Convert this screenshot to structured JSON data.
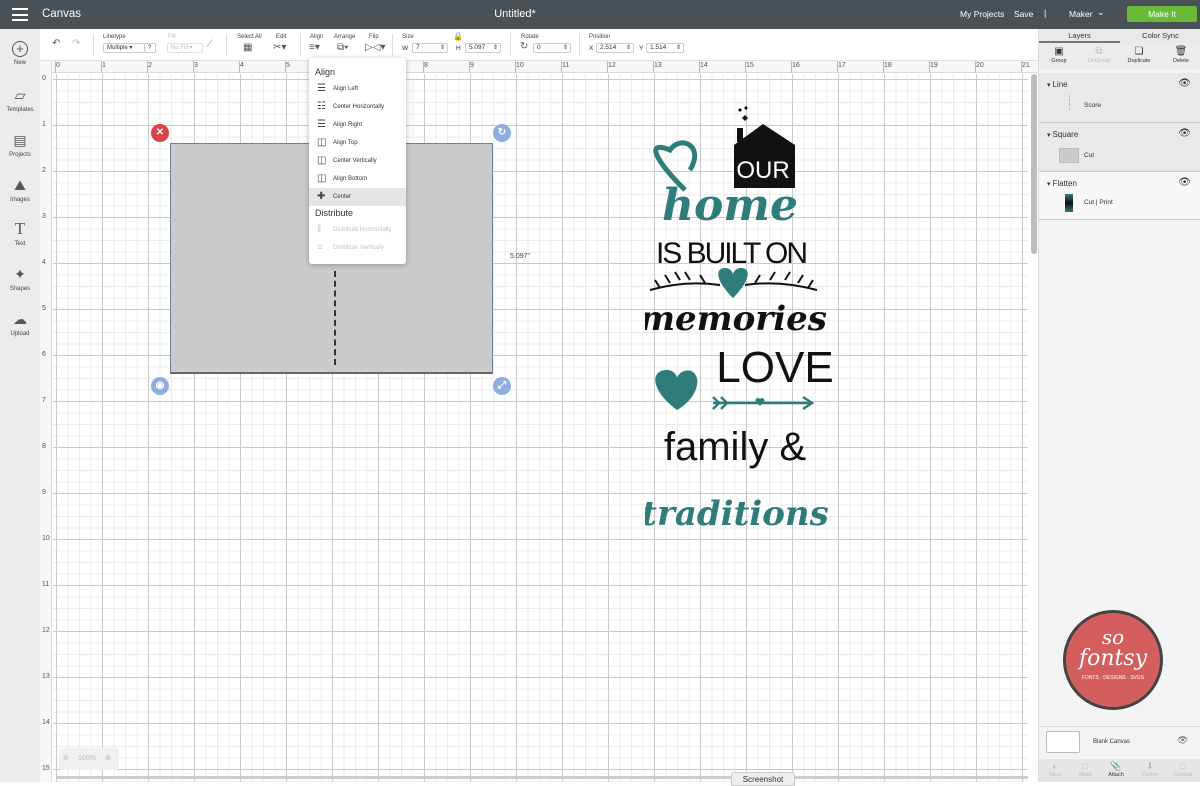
{
  "topbar": {
    "menu_icon": "hamburger-icon",
    "app_title": "Canvas",
    "document_title": "Untitled*",
    "my_projects": "My Projects",
    "save": "Save",
    "separator": "|",
    "machine": "Maker",
    "make_it": "Make It",
    "make_it_color": "#6aba3a"
  },
  "leftnav": {
    "items": [
      {
        "label": "New",
        "icon": "plus-circle-icon"
      },
      {
        "label": "Templates",
        "icon": "tshirt-icon"
      },
      {
        "label": "Projects",
        "icon": "notebook-icon"
      },
      {
        "label": "Images",
        "icon": "image-icon"
      },
      {
        "label": "Text",
        "icon": "text-icon"
      },
      {
        "label": "Shapes",
        "icon": "shapes-icon"
      },
      {
        "label": "Upload",
        "icon": "cloud-upload-icon"
      }
    ]
  },
  "toolbar": {
    "linetype_label": "Linetype",
    "linetype_value": "Multiple",
    "help": "?",
    "fill_label": "Fill",
    "fill_value": "No Fill",
    "select_all": "Select All",
    "edit": "Edit",
    "align": "Align",
    "arrange": "Arrange",
    "flip": "Flip",
    "size_label": "Size",
    "w_label": "W",
    "w_value": "7",
    "h_label": "H",
    "h_value": "5.097",
    "rotate_label": "Rotate",
    "rotate_value": "0",
    "position_label": "Position",
    "x_label": "X",
    "x_value": "2.514",
    "y_label": "Y",
    "y_value": "1.514"
  },
  "rulers": {
    "horizontal": [
      "0",
      "1",
      "2",
      "3",
      "4",
      "5",
      "6",
      "7",
      "8",
      "9",
      "10",
      "11",
      "12",
      "13",
      "14",
      "15",
      "16",
      "17",
      "18",
      "19",
      "20",
      "21"
    ],
    "vertical": [
      "0",
      "1",
      "2",
      "3",
      "4",
      "5",
      "6",
      "7",
      "8",
      "9",
      "10",
      "11",
      "12",
      "13",
      "14",
      "15"
    ]
  },
  "align_menu": {
    "title": "Align",
    "items": [
      {
        "label": "Align Left",
        "state": "enabled"
      },
      {
        "label": "Center Horizontally",
        "state": "enabled"
      },
      {
        "label": "Align Right",
        "state": "enabled"
      },
      {
        "label": "Align Top",
        "state": "enabled"
      },
      {
        "label": "Center Vertically",
        "state": "enabled"
      },
      {
        "label": "Align Bottom",
        "state": "enabled"
      },
      {
        "label": "Center",
        "state": "hovered"
      }
    ],
    "distribute_title": "Distribute",
    "distribute_items": [
      {
        "label": "Distribute Horizontally",
        "state": "disabled"
      },
      {
        "label": "Distribute Vertically",
        "state": "disabled"
      }
    ]
  },
  "canvas": {
    "height_dimension": "5.097\"",
    "zoom_level": "100%",
    "artwork_lines": [
      "OUR",
      "home",
      "IS BUILT ON",
      "memories",
      "LOVE",
      "family &",
      "traditions"
    ],
    "artwork_teal": "#2e7d7a"
  },
  "layers_panel": {
    "tabs": [
      "Layers",
      "Color Sync"
    ],
    "active_tab": "Layers",
    "actions": [
      {
        "label": "Group",
        "enabled": true
      },
      {
        "label": "UnGroup",
        "enabled": false
      },
      {
        "label": "Duplicate",
        "enabled": true
      },
      {
        "label": "Delete",
        "enabled": true
      }
    ],
    "layers": [
      {
        "name": "Line",
        "operation": "Score"
      },
      {
        "name": "Square",
        "operation": "Cut"
      },
      {
        "name": "Flatten",
        "operation": "Cut  |  Print"
      }
    ],
    "blank_canvas": "Blank Canvas",
    "bottom_actions": [
      {
        "label": "Slice",
        "enabled": false
      },
      {
        "label": "Weld",
        "enabled": false
      },
      {
        "label": "Attach",
        "enabled": true
      },
      {
        "label": "Flatten",
        "enabled": false
      },
      {
        "label": "Contour",
        "enabled": false
      }
    ]
  },
  "watermark": {
    "line1": "so",
    "line2": "fontsy",
    "tagline": "FONTS · DESIGNS · SVGS"
  },
  "screenshot_tab": "Screenshot"
}
